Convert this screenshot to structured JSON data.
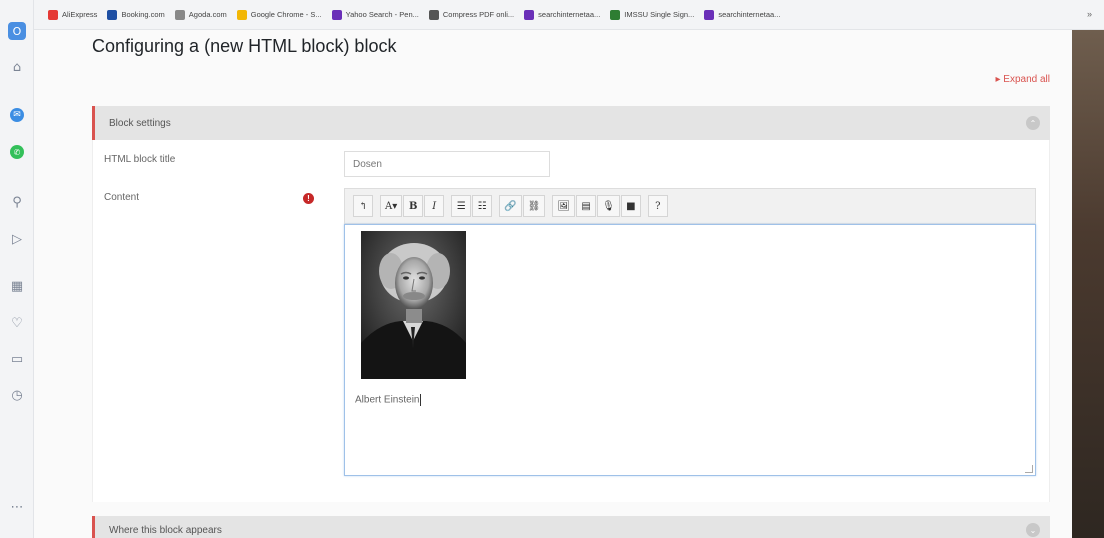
{
  "bookmarks": [
    {
      "label": "AliExpress",
      "icon": "aliexpress-icon",
      "color": "#e53935"
    },
    {
      "label": "Booking.com",
      "icon": "booking-icon",
      "color": "#1e4fa3"
    },
    {
      "label": "Agoda.com",
      "icon": "agoda-icon",
      "color": "#888888"
    },
    {
      "label": "Google Chrome - S...",
      "icon": "chrome-icon",
      "color": "#f2b705"
    },
    {
      "label": "Yahoo Search - Pen...",
      "icon": "yahoo-icon",
      "color": "#6a2fb8"
    },
    {
      "label": "Compress PDF onli...",
      "icon": "pdf-icon",
      "color": "#555555"
    },
    {
      "label": "searchinternetaa...",
      "icon": "search-site-icon",
      "color": "#6a2fb8"
    },
    {
      "label": "IMSSU Single Sign...",
      "icon": "imssu-icon",
      "color": "#2e7d32"
    },
    {
      "label": "searchinternetaa...",
      "icon": "search-site-icon",
      "color": "#6a2fb8"
    }
  ],
  "bookmarks_more": "»",
  "sidebar": {
    "icons": [
      "opera-logo-icon",
      "home-icon",
      "messenger-icon",
      "whatsapp-icon",
      "search-icon",
      "send-icon",
      "apps-icon",
      "heart-icon",
      "history-icon",
      "clock-icon",
      "more-icon"
    ]
  },
  "page": {
    "title": "Configuring a (new HTML block) block",
    "expand_all": "Expand all"
  },
  "block_settings": {
    "header": "Block settings",
    "title_label": "HTML block title",
    "title_value": "Dosen",
    "content_label": "Content",
    "required_mark": "!"
  },
  "toolbar": {
    "buttons": [
      "↰",
      "A▾",
      "B",
      "I",
      "☰",
      "☷",
      "🔗",
      "⛓",
      "🖼",
      "▤",
      "🎙",
      "■",
      "?"
    ]
  },
  "editor": {
    "caption": "Albert Einstein"
  },
  "where_block_appears": {
    "header": "Where this block appears"
  },
  "colors": {
    "accent": "#d9534f",
    "required": "#c62828"
  }
}
